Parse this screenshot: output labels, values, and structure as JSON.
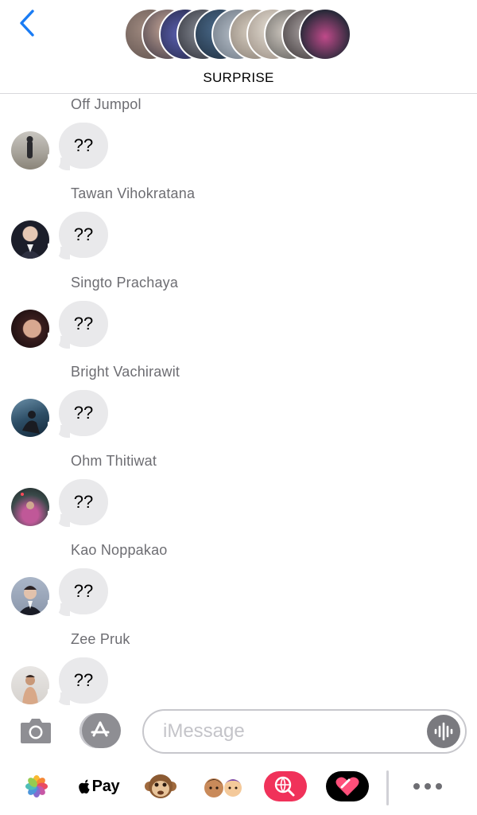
{
  "header": {
    "title": "SURPRISE",
    "back_icon": "chevron-left-icon",
    "accent_color": "#1a7cf4"
  },
  "messages": [
    {
      "sender": "Off Jumpol",
      "text": "??"
    },
    {
      "sender": "Tawan Vihokratana",
      "text": "??"
    },
    {
      "sender": "Singto Prachaya",
      "text": "??"
    },
    {
      "sender": "Bright Vachirawit",
      "text": "??"
    },
    {
      "sender": "Ohm Thitiwat",
      "text": "??"
    },
    {
      "sender": "Kao Noppakao",
      "text": "??"
    },
    {
      "sender": "Zee Pruk",
      "text": "??"
    }
  ],
  "input_bar": {
    "placeholder": "iMessage",
    "value": ""
  },
  "app_drawer": {
    "apple_pay_label": "Pay",
    "items": [
      "photos-icon",
      "apple-pay-icon",
      "monkey-animoji-icon",
      "memoji-icon",
      "web-search-icon",
      "digital-touch-icon",
      "more-icon"
    ]
  },
  "colors": {
    "bubble_gray": "#e9e9eb",
    "sender_name_gray": "#6d6d72",
    "search_pink": "#f0325a"
  }
}
